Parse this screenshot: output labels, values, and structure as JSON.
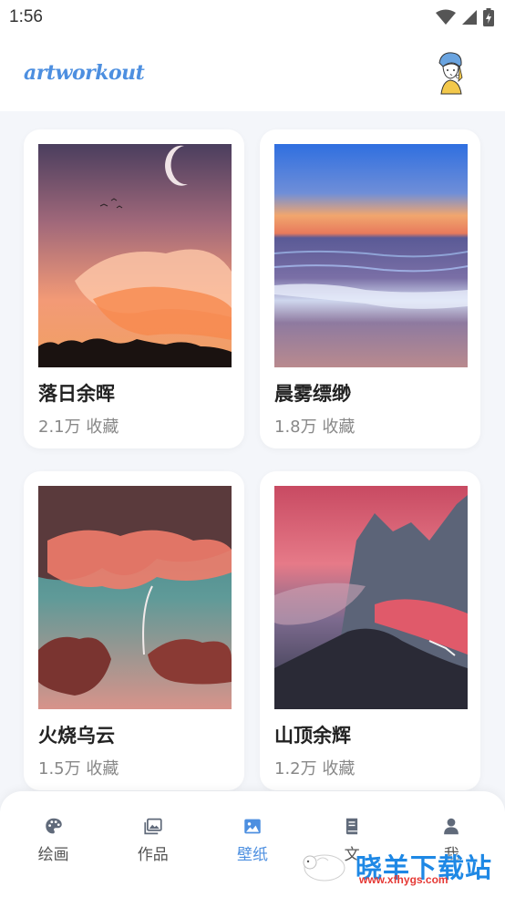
{
  "status_bar": {
    "time": "1:56"
  },
  "header": {
    "logo_text": "artworkout"
  },
  "wallpapers": [
    {
      "title": "落日余晖",
      "meta": "2.1万 收藏",
      "scene": "sunset"
    },
    {
      "title": "晨雾缥缈",
      "meta": "1.8万 收藏",
      "scene": "ocean"
    },
    {
      "title": "火烧乌云",
      "meta": "1.5万 收藏",
      "scene": "clouds"
    },
    {
      "title": "山顶余辉",
      "meta": "1.2万 收藏",
      "scene": "mountain"
    }
  ],
  "bottom_nav": {
    "items": [
      {
        "label": "绘画",
        "icon": "palette-icon"
      },
      {
        "label": "作品",
        "icon": "gallery-icon"
      },
      {
        "label": "壁纸",
        "icon": "image-icon",
        "active": true
      },
      {
        "label": "文",
        "icon": "book-icon"
      },
      {
        "label": "我",
        "icon": "person-icon"
      }
    ]
  },
  "watermark": {
    "text": "晓羊下载站",
    "url": "www.xfhygs.com"
  },
  "colors": {
    "accent": "#4d8fe0",
    "icon_gray": "#606a7a",
    "background": "#f4f6fa"
  }
}
